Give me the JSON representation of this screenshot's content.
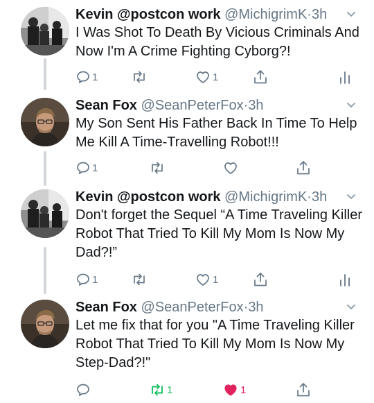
{
  "colors": {
    "icon": "#657786",
    "retweeted": "#17bf63",
    "liked": "#e0245e",
    "thread_line": "#d2d6da"
  },
  "tweets": [
    {
      "name": "Kevin @postcon work",
      "handle": "@MichigrimK",
      "sep": "·",
      "time": "3h",
      "text": "I Was Shot To Death By Vicious Criminals And Now I'm A Crime Fighting Cyborg?!",
      "reply_count": "1",
      "retweet_count": "",
      "like_count": "1",
      "avatar_icon": "group-photo-avatar"
    },
    {
      "name": "Sean Fox",
      "handle": "@SeanPeterFox",
      "sep": "·",
      "time": "3h",
      "text": "My Son Sent His Father Back In Time To Help Me Kill A Time-Travelling Robot!!!",
      "reply_count": "1",
      "retweet_count": "",
      "like_count": "",
      "avatar_icon": "man-portrait-avatar"
    },
    {
      "name": "Kevin @postcon work",
      "handle": "@MichigrimK",
      "sep": "·",
      "time": "3h",
      "text": "Don't forget the Sequel “A Time Traveling Killer Robot That Tried To Kill My Mom Is Now My Dad?!”",
      "reply_count": "1",
      "retweet_count": "",
      "like_count": "1",
      "avatar_icon": "group-photo-avatar"
    },
    {
      "name": "Sean Fox",
      "handle": "@SeanPeterFox",
      "sep": "·",
      "time": "3h",
      "text": "Let me fix that for you \"A Time Traveling Killer Robot That Tried To Kill My Mom Is Now My Step-Dad?!\"",
      "reply_count": "",
      "retweet_count": "1",
      "like_count": "1",
      "avatar_icon": "man-portrait-avatar"
    }
  ]
}
